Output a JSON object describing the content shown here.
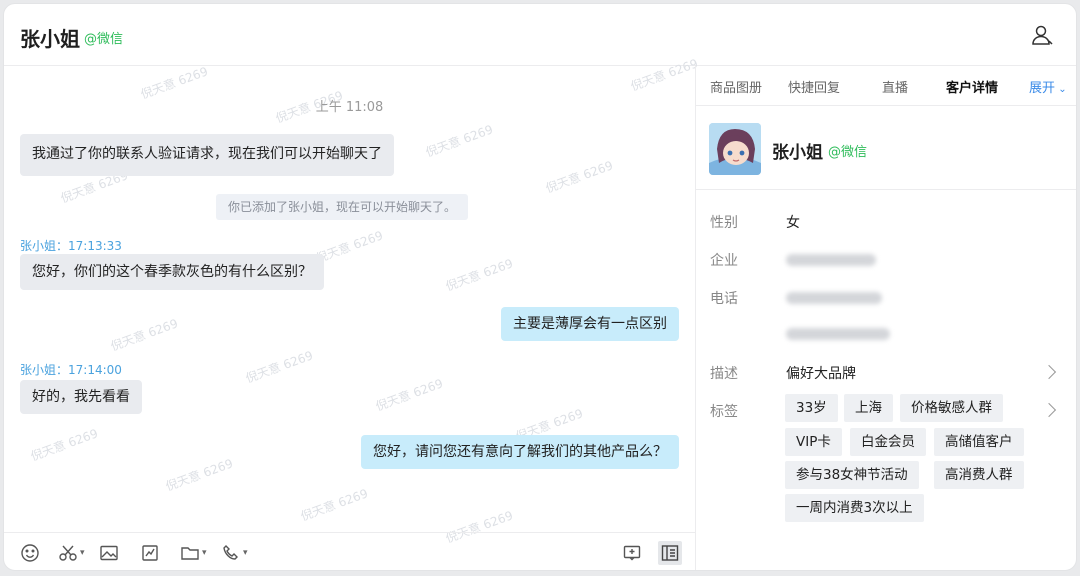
{
  "header": {
    "name": "张小姐",
    "tag": "@微信"
  },
  "chat": {
    "time_divider": "上午 11:08",
    "messages": [
      {
        "text": "我通过了你的联系人验证请求，现在我们可以开始聊天了"
      },
      {
        "text": "你已添加了张小姐，现在可以开始聊天了。"
      },
      {
        "sender": "张小姐：17:13:33",
        "text": "您好，你们的这个春季款灰色的有什么区别？"
      },
      {
        "text": "主要是薄厚会有一点区别"
      },
      {
        "sender": "张小姐：17:14:00",
        "text": "好的，我先看看"
      },
      {
        "text": "您好，请问您还有意向了解我们的其他产品么？"
      }
    ],
    "watermark": "倪天意 6269"
  },
  "toolbar": {
    "icons": [
      "emoji-icon",
      "scissors-icon",
      "image-icon",
      "chart-icon",
      "folder-icon",
      "phone-icon",
      "quick-reply-icon",
      "sidebar-toggle-icon"
    ]
  },
  "panel": {
    "tabs": [
      "商品图册",
      "快捷回复",
      "直播",
      "客户详情",
      "展开"
    ],
    "profile": {
      "name": "张小姐",
      "tag": "@微信"
    },
    "fields": {
      "gender_label": "性别",
      "gender_value": "女",
      "company_label": "企业",
      "phone_label": "电话",
      "desc_label": "描述",
      "desc_value": "偏好大品牌",
      "tags_label": "标签"
    },
    "tags": [
      "33岁",
      "上海",
      "价格敏感人群",
      "VIP卡",
      "白金会员",
      "高储值客户",
      "参与38女神节活动",
      "高消费人群",
      "一周内消费3次以上"
    ]
  },
  "colors": {
    "wechat_green": "#2ebc5a",
    "link_blue": "#3b8be8",
    "right_bubble": "#c8ecfb",
    "left_bubble": "#e9ebef"
  }
}
